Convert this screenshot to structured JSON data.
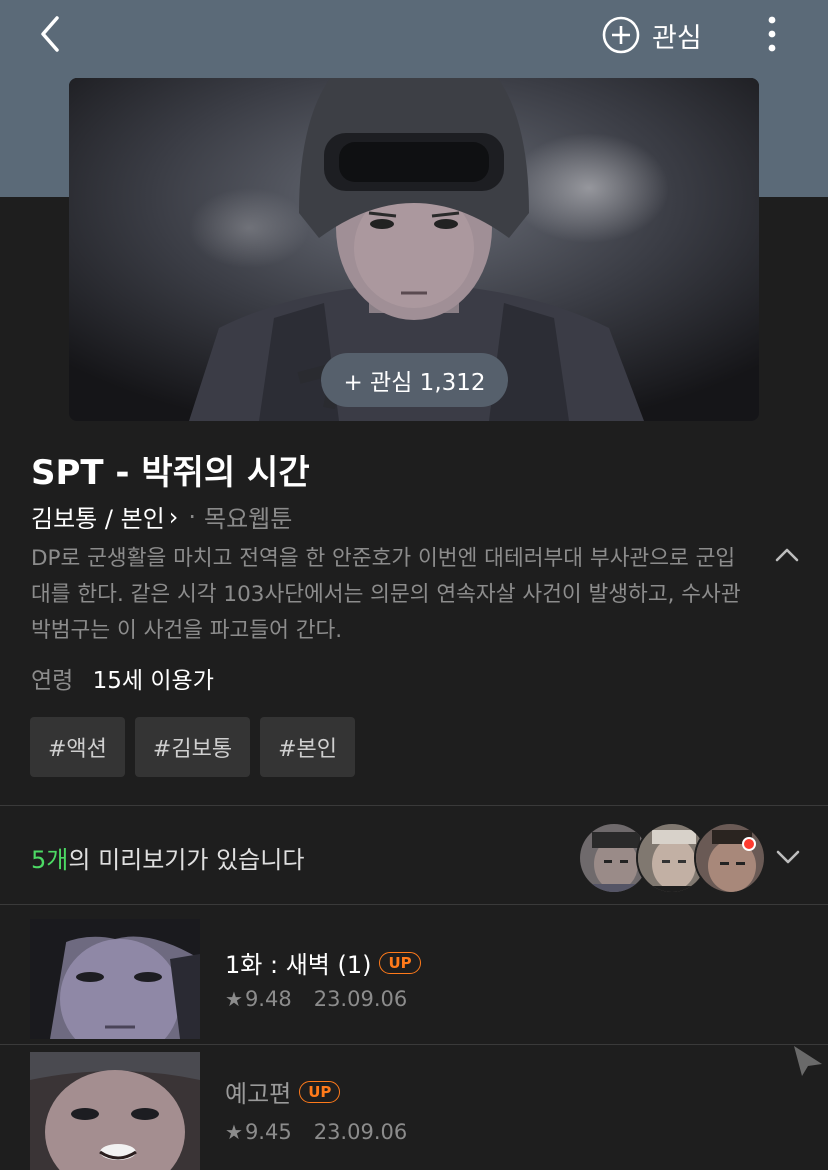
{
  "header": {
    "watch_label": "관심",
    "back_icon": "back-chevron-icon",
    "more_icon": "more-vertical-icon"
  },
  "cover": {
    "favorite_pill": "+ 관심 1,312"
  },
  "webtoon": {
    "title": "SPT - 박쥐의 시간",
    "author": "김보통 / 본인",
    "publish_day": "목요웹툰",
    "synopsis": "DP로 군생활을 마치고 전역을 한 안준호가 이번엔 대테러부대 부사관으로 군입대를 한다. 같은 시각 103사단에서는 의문의 연속자살 사건이 발생하고, 수사관 박범구는 이 사건을 파고들어 간다.",
    "age_label": "연령",
    "age_value": "15세 이용가",
    "tags": [
      "#액션",
      "#김보통",
      "#본인"
    ]
  },
  "preview": {
    "count": "5개",
    "text": "의 미리보기가 있습니다"
  },
  "episodes": [
    {
      "title": "1화 : 새벽 (1)",
      "badge": "UP",
      "rating": "9.48",
      "date": "23.09.06"
    },
    {
      "title": "예고편",
      "badge": "UP",
      "rating": "9.45",
      "date": "23.09.06"
    }
  ],
  "colors": {
    "header_bg": "#5b6a78",
    "page_bg": "#1e1e1e",
    "accent_green": "#4cd964",
    "up_orange": "#ff7a1a",
    "badge_red": "#ff3b30"
  }
}
